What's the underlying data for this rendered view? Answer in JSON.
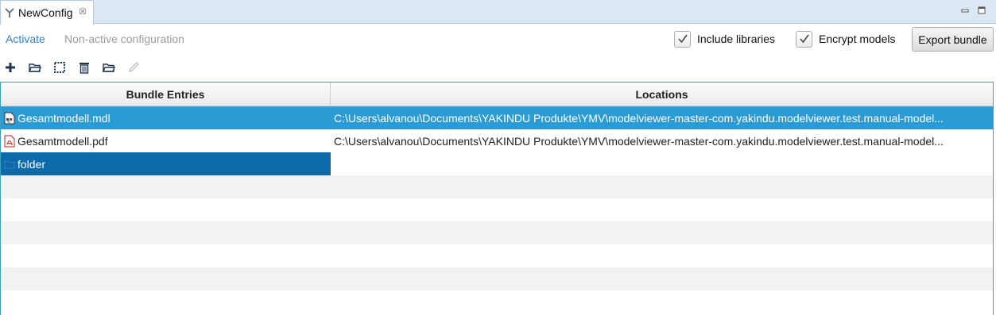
{
  "tab": {
    "title": "NewConfig",
    "icon": "config-icon",
    "close_symbol": "☒"
  },
  "window_controls": [
    "minimize-icon",
    "maximize-icon"
  ],
  "header": {
    "activate_link": "Activate",
    "status": "Non-active configuration",
    "include_libraries": {
      "label": "Include libraries",
      "checked": true
    },
    "encrypt_models": {
      "label": "Encrypt models",
      "checked": true
    },
    "export_button": "Export bundle"
  },
  "toolbar": {
    "items": [
      "add-icon",
      "open-folder-icon",
      "select-all-icon",
      "delete-icon",
      "folder-icon",
      "edit-icon"
    ]
  },
  "table": {
    "columns": [
      "Bundle Entries",
      "Locations"
    ],
    "rows": [
      {
        "name": "Gesamtmodell.mdl",
        "location": "C:\\Users\\alvanou\\Documents\\YAKINDU Produkte\\YMV\\modelviewer-master-com.yakindu.modelviewer.test.manual-model...",
        "icon": "mdl-file-icon",
        "selected": true
      },
      {
        "name": "Gesamtmodell.pdf",
        "location": "C:\\Users\\alvanou\\Documents\\YAKINDU Produkte\\YMV\\modelviewer-master-com.yakindu.modelviewer.test.manual-model...",
        "icon": "pdf-file-icon",
        "selected": false
      },
      {
        "name": "folder",
        "location": "",
        "icon": "folder-icon",
        "selected": false,
        "editing": true
      }
    ]
  },
  "colors": {
    "accent": "#2f82c8",
    "selection": "#2b9bd6",
    "focus": "#0d6aaa",
    "tabbar": "#dce7f5"
  }
}
